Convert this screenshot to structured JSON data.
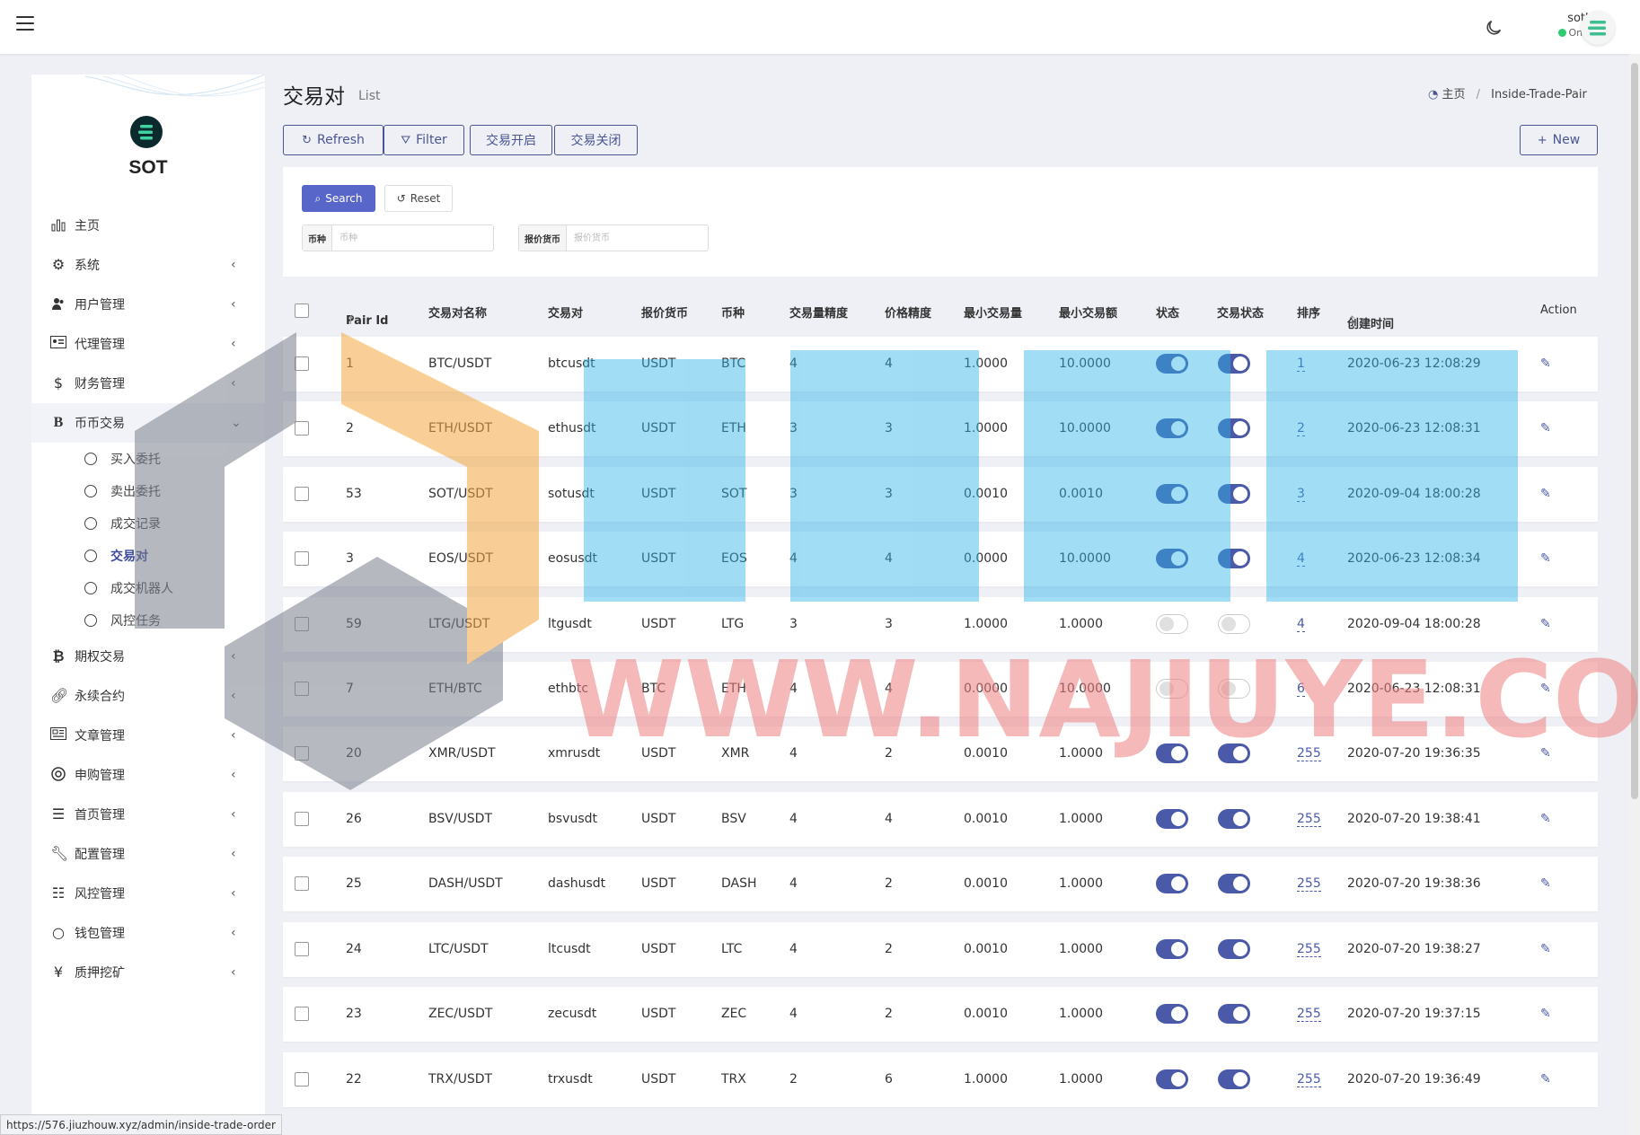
{
  "header": {
    "username": "sotbit",
    "status": "Online"
  },
  "brand": "SOT",
  "menu": {
    "home": "主页",
    "system": "系统",
    "users": "用户管理",
    "agents": "代理管理",
    "finance": "财务管理",
    "coin_trade": "币币交易",
    "coin_sub": [
      "买入委托",
      "卖出委托",
      "成交记录",
      "交易对",
      "成交机器人",
      "风控任务"
    ],
    "options": "期权交易",
    "perpetual": "永续合约",
    "articles": "文章管理",
    "subscription": "申购管理",
    "homepage": "首页管理",
    "config": "配置管理",
    "risk": "风控管理",
    "wallet": "钱包管理",
    "mining": "质押挖矿"
  },
  "page": {
    "title": "交易对",
    "subtitle": "List"
  },
  "breadcrumb": {
    "home": "主页",
    "current": "Inside-Trade-Pair"
  },
  "toolbar": {
    "refresh": "Refresh",
    "filter": "Filter",
    "open": "交易开启",
    "close": "交易关闭",
    "new": "New"
  },
  "filter": {
    "search": "Search",
    "reset": "Reset",
    "coin_label": "币种",
    "coin_placeholder": "币种",
    "quote_label": "报价货币",
    "quote_placeholder": "报价货币"
  },
  "table": {
    "headers": [
      "Pair Id",
      "交易对名称",
      "交易对",
      "报价货币",
      "币种",
      "交易量精度",
      "价格精度",
      "最小交易量",
      "最小交易额",
      "状态",
      "交易状态",
      "排序",
      "创建时间",
      "Action"
    ],
    "rows": [
      {
        "id": "1",
        "name": "BTC/USDT",
        "pair": "btcusdt",
        "quote": "USDT",
        "coin": "BTC",
        "vol_prec": "4",
        "price_prec": "4",
        "min_vol": "1.0000",
        "min_amt": "10.0000",
        "status": true,
        "trade_status": true,
        "sort": "1",
        "created": "2020-06-23 12:08:29"
      },
      {
        "id": "2",
        "name": "ETH/USDT",
        "pair": "ethusdt",
        "quote": "USDT",
        "coin": "ETH",
        "vol_prec": "3",
        "price_prec": "3",
        "min_vol": "1.0000",
        "min_amt": "10.0000",
        "status": true,
        "trade_status": true,
        "sort": "2",
        "created": "2020-06-23 12:08:31"
      },
      {
        "id": "53",
        "name": "SOT/USDT",
        "pair": "sotusdt",
        "quote": "USDT",
        "coin": "SOT",
        "vol_prec": "3",
        "price_prec": "3",
        "min_vol": "0.0010",
        "min_amt": "0.0010",
        "status": true,
        "trade_status": true,
        "sort": "3",
        "created": "2020-09-04 18:00:28"
      },
      {
        "id": "3",
        "name": "EOS/USDT",
        "pair": "eosusdt",
        "quote": "USDT",
        "coin": "EOS",
        "vol_prec": "4",
        "price_prec": "4",
        "min_vol": "0.0000",
        "min_amt": "10.0000",
        "status": true,
        "trade_status": true,
        "sort": "4",
        "created": "2020-06-23 12:08:34"
      },
      {
        "id": "59",
        "name": "LTG/USDT",
        "pair": "ltgusdt",
        "quote": "USDT",
        "coin": "LTG",
        "vol_prec": "3",
        "price_prec": "3",
        "min_vol": "1.0000",
        "min_amt": "1.0000",
        "status": false,
        "trade_status": false,
        "sort": "4",
        "created": "2020-09-04 18:00:28"
      },
      {
        "id": "7",
        "name": "ETH/BTC",
        "pair": "ethbtc",
        "quote": "BTC",
        "coin": "ETH",
        "vol_prec": "4",
        "price_prec": "4",
        "min_vol": "0.0000",
        "min_amt": "10.0000",
        "status": false,
        "trade_status": false,
        "sort": "6",
        "created": "2020-06-23 12:08:31"
      },
      {
        "id": "20",
        "name": "XMR/USDT",
        "pair": "xmrusdt",
        "quote": "USDT",
        "coin": "XMR",
        "vol_prec": "4",
        "price_prec": "2",
        "min_vol": "0.0010",
        "min_amt": "1.0000",
        "status": true,
        "trade_status": true,
        "sort": "255",
        "created": "2020-07-20 19:36:35"
      },
      {
        "id": "26",
        "name": "BSV/USDT",
        "pair": "bsvusdt",
        "quote": "USDT",
        "coin": "BSV",
        "vol_prec": "4",
        "price_prec": "4",
        "min_vol": "0.0010",
        "min_amt": "1.0000",
        "status": true,
        "trade_status": true,
        "sort": "255",
        "created": "2020-07-20 19:38:41"
      },
      {
        "id": "25",
        "name": "DASH/USDT",
        "pair": "dashusdt",
        "quote": "USDT",
        "coin": "DASH",
        "vol_prec": "4",
        "price_prec": "2",
        "min_vol": "0.0010",
        "min_amt": "1.0000",
        "status": true,
        "trade_status": true,
        "sort": "255",
        "created": "2020-07-20 19:38:36"
      },
      {
        "id": "24",
        "name": "LTC/USDT",
        "pair": "ltcusdt",
        "quote": "USDT",
        "coin": "LTC",
        "vol_prec": "4",
        "price_prec": "2",
        "min_vol": "0.0010",
        "min_amt": "1.0000",
        "status": true,
        "trade_status": true,
        "sort": "255",
        "created": "2020-07-20 19:38:27"
      },
      {
        "id": "23",
        "name": "ZEC/USDT",
        "pair": "zecusdt",
        "quote": "USDT",
        "coin": "ZEC",
        "vol_prec": "4",
        "price_prec": "2",
        "min_vol": "0.0010",
        "min_amt": "1.0000",
        "status": true,
        "trade_status": true,
        "sort": "255",
        "created": "2020-07-20 19:37:15"
      },
      {
        "id": "22",
        "name": "TRX/USDT",
        "pair": "trxusdt",
        "quote": "USDT",
        "coin": "TRX",
        "vol_prec": "2",
        "price_prec": "6",
        "min_vol": "1.0000",
        "min_amt": "1.0000",
        "status": true,
        "trade_status": true,
        "sort": "255",
        "created": "2020-07-20 19:36:49"
      }
    ]
  },
  "status_url": "https://576.jiuzhouw.xyz/admin/inside-trade-order",
  "watermark": {
    "text": "WWW.NAJIUYE.COM"
  },
  "colors": {
    "accent": "#4a5aa8",
    "search_btn": "#5866c9",
    "online": "#2ecc71"
  }
}
